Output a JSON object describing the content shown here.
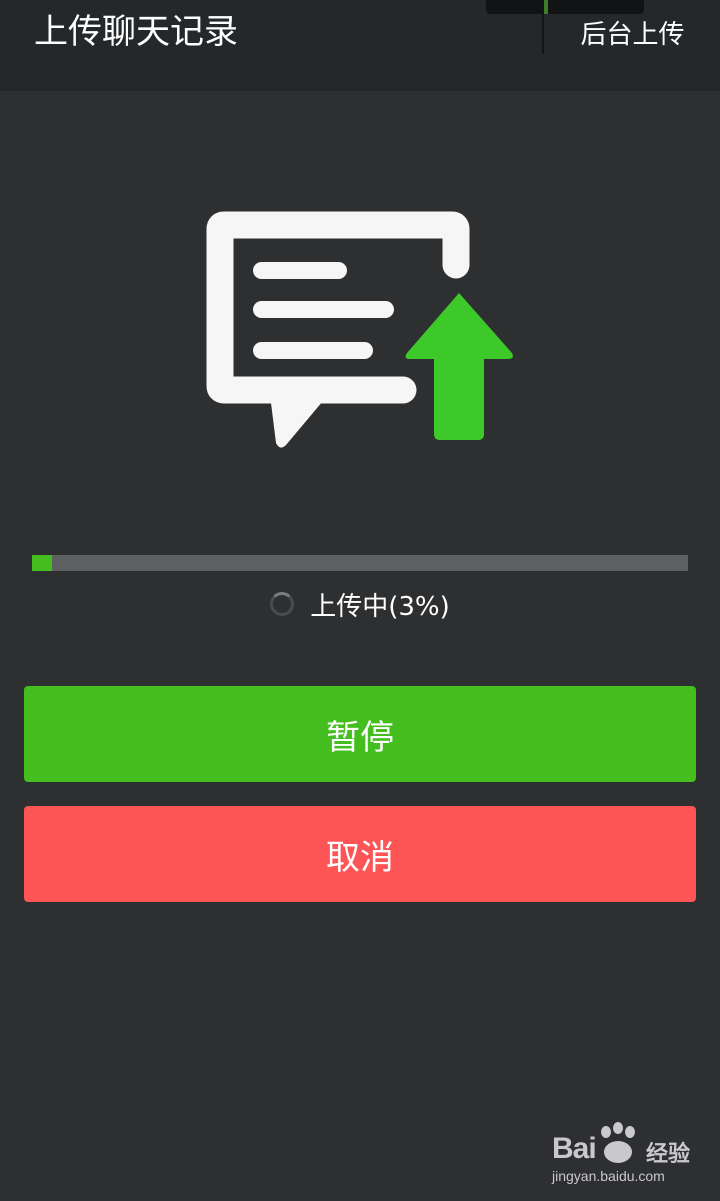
{
  "header": {
    "title": "上传聊天记录",
    "action_label": "后台上传"
  },
  "upload": {
    "progress_percent": 3,
    "status_text": "上传中(3%)"
  },
  "buttons": {
    "pause_label": "暂停",
    "cancel_label": "取消"
  },
  "colors": {
    "accent_green": "#44be1e",
    "cancel_red": "#fd5556",
    "background": "#2e2f31",
    "header_background": "#25282b"
  },
  "illustration": {
    "icon": "chat-upload-icon"
  },
  "watermark": {
    "logo_text": "Bai",
    "product_text": "经验",
    "url": "jingyan.baidu.com"
  }
}
